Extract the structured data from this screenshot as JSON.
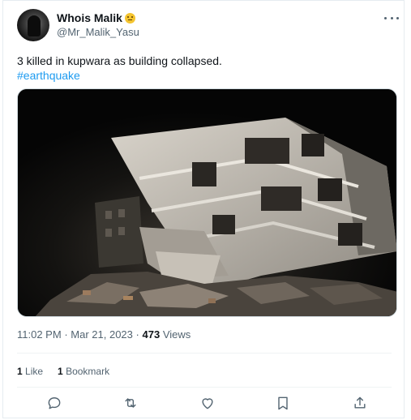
{
  "author": {
    "display_name": "Whois Malik",
    "emoji_icon": "thinking-face-emoji",
    "handle": "@Mr_Malik_Yasu"
  },
  "tweet": {
    "text": "3 killed in kupwara as building collapsed.",
    "hashtag": "#earthquake"
  },
  "meta": {
    "time": "11:02 PM",
    "dot": "·",
    "date": "Mar 21, 2023",
    "views_count": "473",
    "views_label": "Views"
  },
  "stats": {
    "likes_count": "1",
    "likes_label": "Like",
    "bookmarks_count": "1",
    "bookmarks_label": "Bookmark"
  },
  "icons": {
    "more": "more-dots-icon",
    "reply": "reply-icon",
    "retweet": "retweet-icon",
    "like": "heart-icon",
    "bookmark": "bookmark-icon",
    "share": "share-icon"
  },
  "colors": {
    "link": "#1d9bf0",
    "secondary_text": "#536471",
    "primary_text": "#0f1419",
    "divider": "#eff3f4"
  }
}
